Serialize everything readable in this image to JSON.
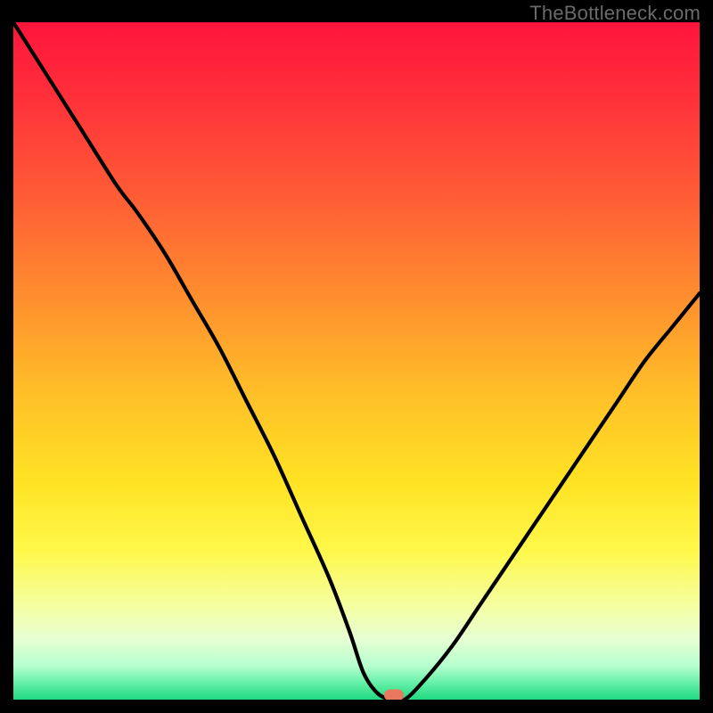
{
  "watermark": "TheBottleneck.com",
  "colors": {
    "gradient_stops": [
      {
        "pos": 0.0,
        "color": "#ff143c"
      },
      {
        "pos": 0.1,
        "color": "#ff2d3a"
      },
      {
        "pos": 0.25,
        "color": "#ff5a36"
      },
      {
        "pos": 0.4,
        "color": "#ff8c2e"
      },
      {
        "pos": 0.55,
        "color": "#ffc028"
      },
      {
        "pos": 0.68,
        "color": "#ffe324"
      },
      {
        "pos": 0.78,
        "color": "#fff84a"
      },
      {
        "pos": 0.86,
        "color": "#f5ffa0"
      },
      {
        "pos": 0.91,
        "color": "#e7ffd2"
      },
      {
        "pos": 0.95,
        "color": "#b7ffcf"
      },
      {
        "pos": 0.975,
        "color": "#66f0a8"
      },
      {
        "pos": 1.0,
        "color": "#20d980"
      }
    ],
    "marker": "#e8795f",
    "curve": "#000000",
    "background": "#000000"
  },
  "chart_data": {
    "type": "line",
    "title": "",
    "xlabel": "",
    "ylabel": "",
    "xlim": [
      0,
      100
    ],
    "ylim": [
      0,
      100
    ],
    "series": [
      {
        "name": "bottleneck-curve",
        "x": [
          0,
          5,
          10,
          15,
          18,
          22,
          26,
          30,
          34,
          38,
          42,
          46,
          49,
          51,
          53,
          55,
          57,
          60,
          64,
          68,
          72,
          76,
          80,
          84,
          88,
          92,
          96,
          100
        ],
        "y": [
          100,
          92,
          84,
          76,
          72,
          66,
          59,
          52,
          44,
          36,
          27,
          18,
          10,
          4,
          1,
          0,
          0,
          3,
          8,
          14,
          20,
          26,
          32,
          38,
          44,
          50,
          55,
          60
        ]
      }
    ],
    "marker": {
      "x": 55.5,
      "y": 0.6
    },
    "annotations": []
  }
}
